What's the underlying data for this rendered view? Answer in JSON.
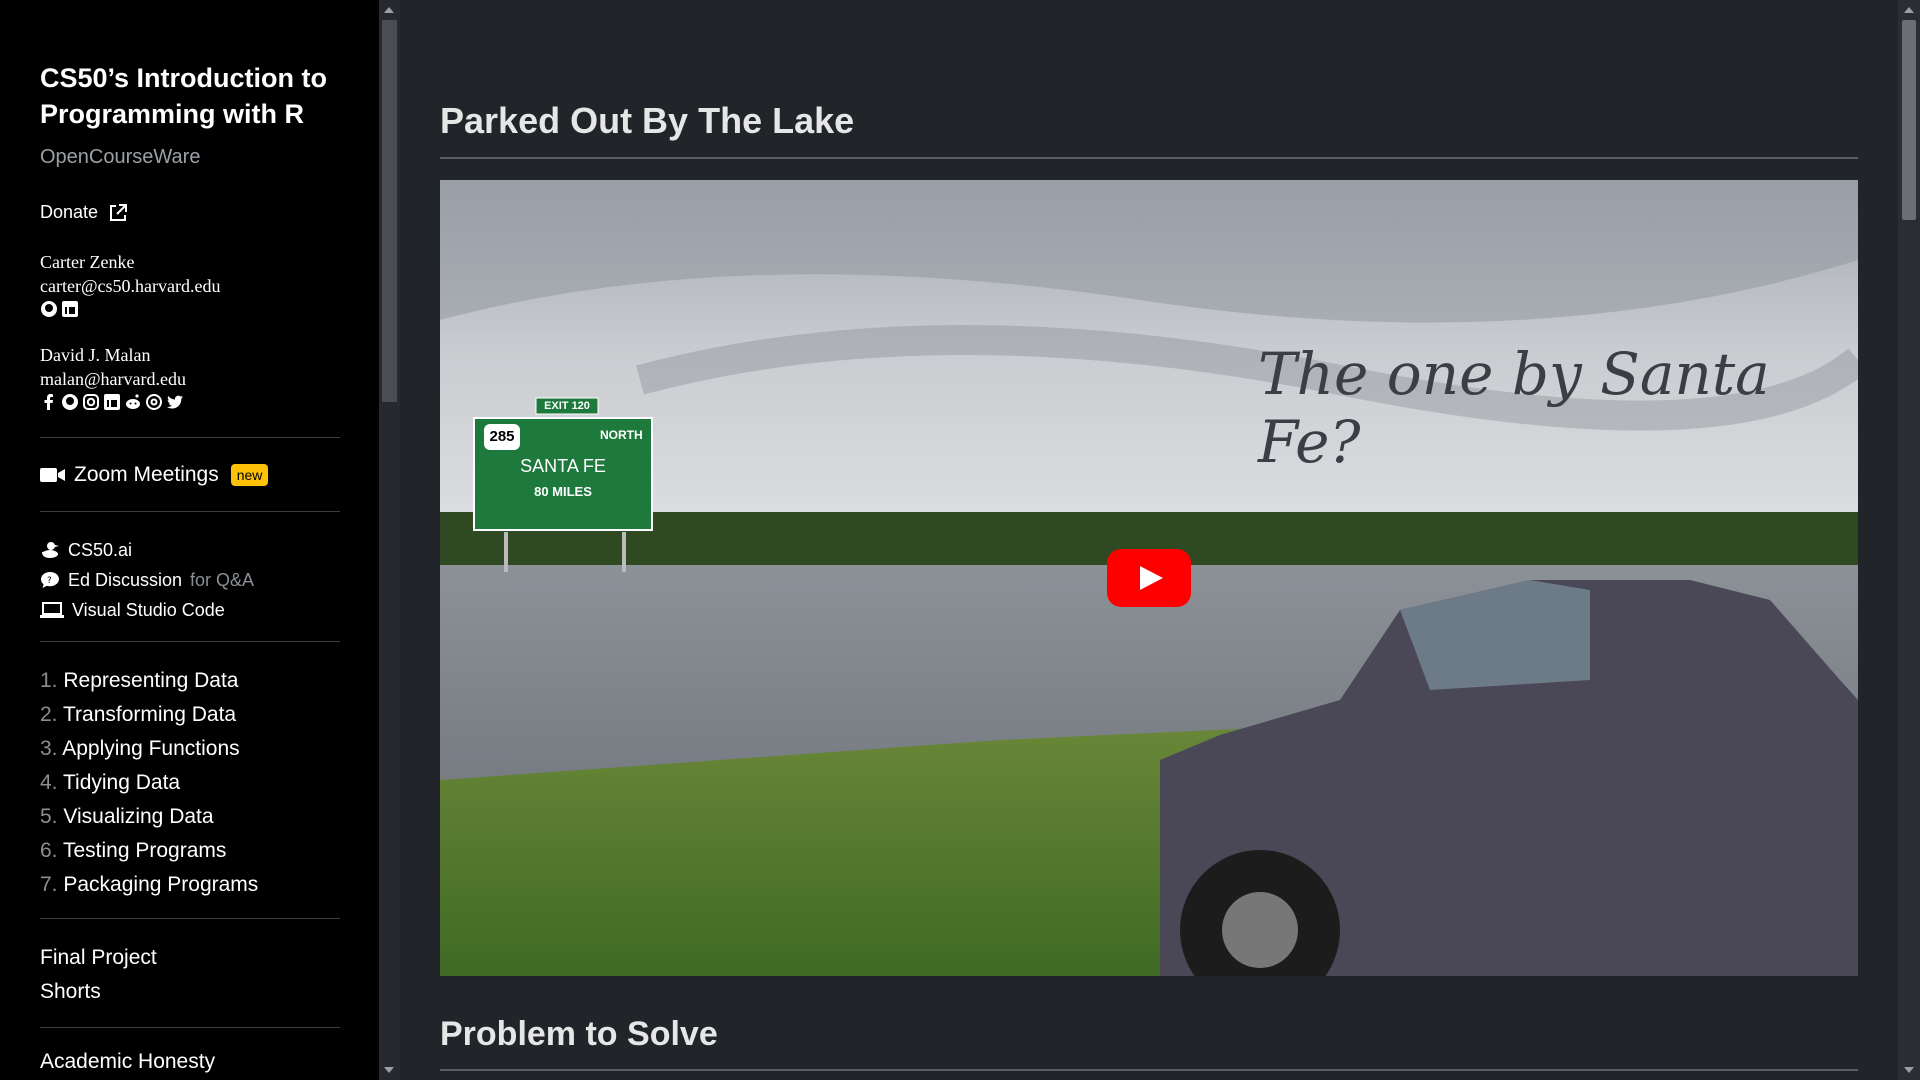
{
  "sidebar": {
    "title": "CS50’s Introduction to Programming with R",
    "subtitle": "OpenCourseWare",
    "donate": "Donate",
    "people": [
      {
        "name": "Carter Zenke",
        "email": "carter@cs50.harvard.edu"
      },
      {
        "name": "David J. Malan",
        "email": "malan@harvard.edu"
      }
    ],
    "zoom": {
      "label": "Zoom Meetings",
      "badge": "new"
    },
    "links": {
      "ai": "CS50.ai",
      "ed": "Ed Discussion",
      "ed_note": "for Q&A",
      "vscode": "Visual Studio Code"
    },
    "lectures": [
      {
        "num": "1.",
        "label": "Representing Data"
      },
      {
        "num": "2.",
        "label": "Transforming Data"
      },
      {
        "num": "3.",
        "label": "Applying Functions"
      },
      {
        "num": "4.",
        "label": "Tidying Data"
      },
      {
        "num": "5.",
        "label": "Visualizing Data"
      },
      {
        "num": "6.",
        "label": "Testing Programs"
      },
      {
        "num": "7.",
        "label": "Packaging Programs"
      }
    ],
    "final_project": "Final Project",
    "shorts": "Shorts",
    "academic_honesty": "Academic Honesty"
  },
  "main": {
    "title": "Parked Out By The Lake",
    "video": {
      "overlay_text": "The one by Santa Fe?",
      "sign": {
        "exit": "EXIT 120",
        "route": "285",
        "direction": "NORTH",
        "city": "SANTA FE",
        "distance": "80 MILES"
      }
    },
    "section_title": "Problem to Solve"
  },
  "colors": {
    "accent": "#ffc107",
    "youtube_red": "#ff0000",
    "sign_green": "#1e7a3c"
  }
}
